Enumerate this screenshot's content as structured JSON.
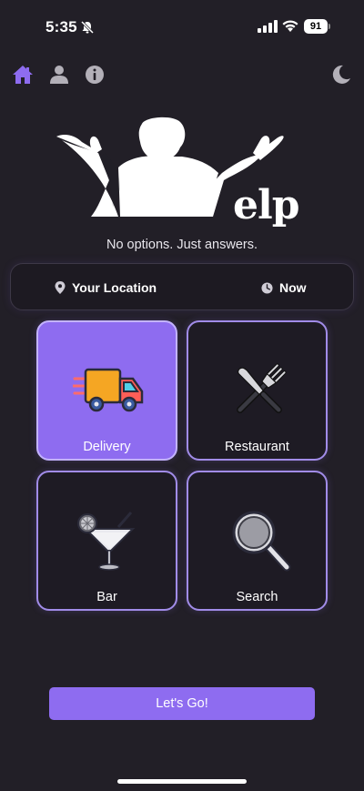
{
  "status_bar": {
    "time": "5:35",
    "battery": "91"
  },
  "nav": {
    "icons": [
      "home-icon",
      "profile-icon",
      "info-icon",
      "dark-mode-icon"
    ],
    "accent": "#8e6cf0"
  },
  "logo": {
    "text": "elp"
  },
  "tagline": "No options. Just answers.",
  "location_bar": {
    "location_label": "Your Location",
    "time_label": "Now"
  },
  "categories": [
    {
      "label": "Delivery",
      "icon": "delivery-truck-icon",
      "selected": true
    },
    {
      "label": "Restaurant",
      "icon": "fork-knife-icon",
      "selected": false
    },
    {
      "label": "Bar",
      "icon": "cocktail-icon",
      "selected": false
    },
    {
      "label": "Search",
      "icon": "magnifier-icon",
      "selected": false
    }
  ],
  "cta_label": "Let's Go!",
  "colors": {
    "background": "#221f27",
    "accent": "#8e6cf0",
    "tile_border": "#a18ce8"
  }
}
